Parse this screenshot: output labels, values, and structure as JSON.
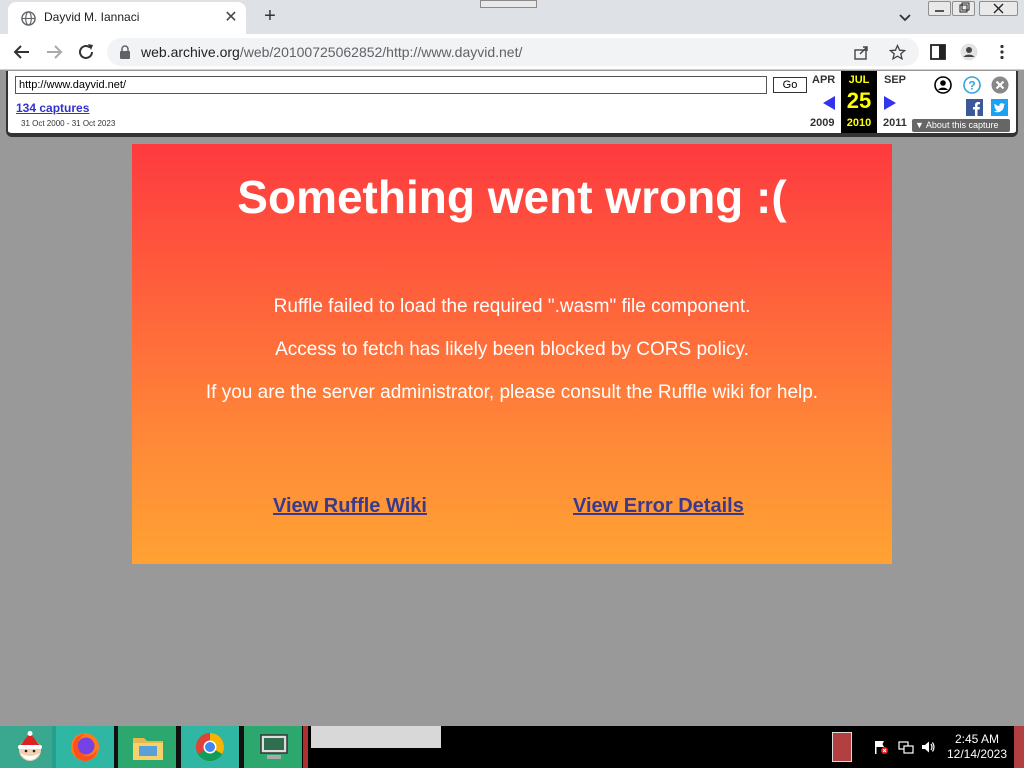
{
  "browser": {
    "tab_title": "Dayvid M. Iannaci",
    "tab_close": "✕",
    "new_tab": "+",
    "url_host": "web.archive.org",
    "url_path": "/web/20100725062852/http://www.dayvid.net/"
  },
  "wayback": {
    "url_value": "http://www.dayvid.net/",
    "go_label": "Go",
    "captures_label": "134 captures",
    "captures_range": "31 Oct 2000 - 31 Oct 2023",
    "prev_month": "APR",
    "prev_year": "2009",
    "current_month": "JUL",
    "current_day": "25",
    "current_year": "2010",
    "next_month": "SEP",
    "next_year": "2011",
    "about_label": "About this capture"
  },
  "ruffle": {
    "title": "Something went wrong :(",
    "lines": [
      "Ruffle failed to load the required \".wasm\" file component.",
      "Access to fetch has likely been blocked by CORS policy.",
      "If you are the server administrator, please consult the Ruffle wiki for help."
    ],
    "link_wiki": "View Ruffle Wiki",
    "link_details": "View Error Details"
  },
  "taskbar": {
    "time": "2:45 AM",
    "date": "12/14/2023"
  },
  "colors": {
    "panel_top": "#fe3a3f",
    "panel_bottom": "#ffa233",
    "link": "#3a3a8c",
    "wayback_highlight": "#ffff00",
    "wayback_arrow": "#3333ee"
  }
}
